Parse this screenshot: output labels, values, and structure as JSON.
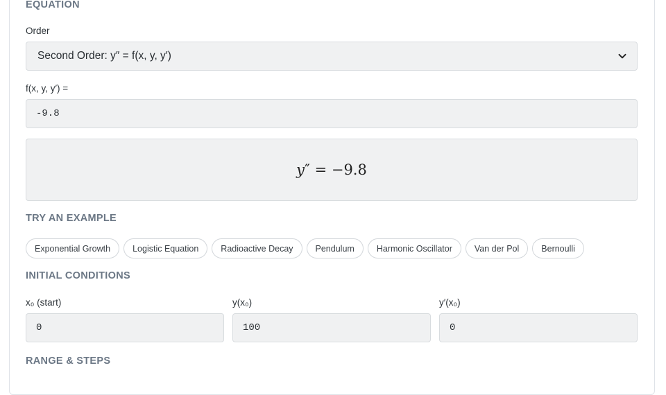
{
  "equation": {
    "section_title": "EQUATION",
    "order_label": "Order",
    "order_value": "Second Order: y″ = f(x, y, y′)",
    "f_label": "f(x, y, y′) =",
    "f_value": "-9.8",
    "preview": {
      "lhs_var": "y",
      "lhs_prime": "″",
      "equals": " = ",
      "rhs": "−9.8"
    }
  },
  "examples": {
    "section_title": "TRY AN EXAMPLE",
    "items": [
      "Exponential Growth",
      "Logistic Equation",
      "Radioactive Decay",
      "Pendulum",
      "Harmonic Oscillator",
      "Van der Pol",
      "Bernoulli"
    ]
  },
  "initial_conditions": {
    "section_title": "INITIAL CONDITIONS",
    "x0_label": "x₀ (start)",
    "x0_value": "0",
    "y0_label": "y(x₀)",
    "y0_value": "100",
    "yp0_label": "y′(x₀)",
    "yp0_value": "0"
  },
  "range_steps": {
    "section_title": "RANGE & STEPS"
  },
  "icons": {
    "order_dropdown": "chevron-down-icon"
  }
}
